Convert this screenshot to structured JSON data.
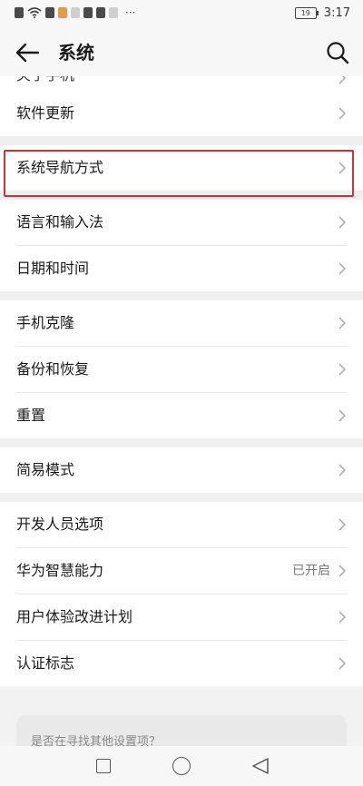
{
  "status_bar": {
    "battery": "19",
    "time": "3:17",
    "more": "···"
  },
  "header": {
    "title": "系统",
    "back_icon": "arrow-left-icon",
    "search_icon": "search-icon"
  },
  "groups": [
    {
      "items": [
        {
          "label": "关于手机",
          "partial": true
        },
        {
          "label": "软件更新"
        }
      ]
    },
    {
      "items": [
        {
          "label": "系统导航方式",
          "highlighted": true
        }
      ]
    },
    {
      "items": [
        {
          "label": "语言和输入法"
        },
        {
          "label": "日期和时间"
        }
      ]
    },
    {
      "items": [
        {
          "label": "手机克隆"
        },
        {
          "label": "备份和恢复"
        },
        {
          "label": "重置"
        }
      ]
    },
    {
      "items": [
        {
          "label": "简易模式"
        }
      ]
    },
    {
      "items": [
        {
          "label": "开发人员选项"
        },
        {
          "label": "华为智慧能力",
          "value": "已开启"
        },
        {
          "label": "用户体验改进计划"
        },
        {
          "label": "认证标志"
        }
      ]
    }
  ],
  "hint": "是否在寻找其他设置项？",
  "colors": {
    "highlight": "#c0383c",
    "background": "#f2f2f2"
  }
}
